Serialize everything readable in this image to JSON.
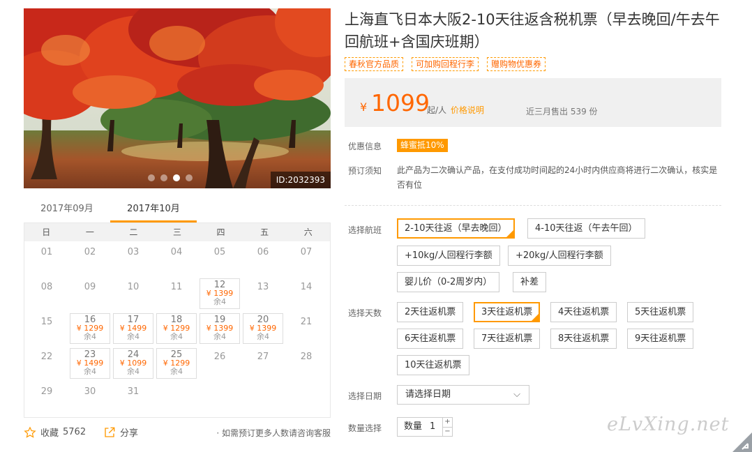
{
  "photo": {
    "id_label": "ID:2032393",
    "dots": 4,
    "active_dot": 2
  },
  "calendar": {
    "months": [
      "2017年09月",
      "2017年10月"
    ],
    "active_month": 1,
    "weekdays": [
      "日",
      "一",
      "二",
      "三",
      "四",
      "五",
      "六"
    ],
    "leading_blanks": 0,
    "days": [
      {
        "day": "01"
      },
      {
        "day": "02"
      },
      {
        "day": "03"
      },
      {
        "day": "04"
      },
      {
        "day": "05"
      },
      {
        "day": "06"
      },
      {
        "day": "07"
      },
      {
        "day": "08"
      },
      {
        "day": "09"
      },
      {
        "day": "10"
      },
      {
        "day": "11"
      },
      {
        "day": "12",
        "price": "¥ 1399",
        "remain": "余4"
      },
      {
        "day": "13"
      },
      {
        "day": "14"
      },
      {
        "day": "15"
      },
      {
        "day": "16",
        "price": "¥ 1299",
        "remain": "余4"
      },
      {
        "day": "17",
        "price": "¥ 1499",
        "remain": "余4"
      },
      {
        "day": "18",
        "price": "¥ 1299",
        "remain": "余4"
      },
      {
        "day": "19",
        "price": "¥ 1399",
        "remain": "余4"
      },
      {
        "day": "20",
        "price": "¥ 1399",
        "remain": "余4"
      },
      {
        "day": "21"
      },
      {
        "day": "22"
      },
      {
        "day": "23",
        "price": "¥ 1499",
        "remain": "余4"
      },
      {
        "day": "24",
        "price": "¥ 1099",
        "remain": "余4"
      },
      {
        "day": "25",
        "price": "¥ 1299",
        "remain": "余4"
      },
      {
        "day": "26"
      },
      {
        "day": "27"
      },
      {
        "day": "28"
      },
      {
        "day": "29"
      },
      {
        "day": "30"
      },
      {
        "day": "31"
      }
    ]
  },
  "footer": {
    "favorite_label": "收藏",
    "favorite_count": "5762",
    "share_label": "分享",
    "consult_text": "· 如需预订更多人数请咨询客服"
  },
  "product": {
    "title": "上海直飞日本大阪2-10天往返含税机票（早去晚回/午去午回航班+含国庆班期）",
    "tags": [
      "春秋官方品质",
      "可加购回程行李",
      "赠购物优惠券"
    ]
  },
  "price": {
    "currency": "¥",
    "value": "1099",
    "unit": "起/人",
    "note": "价格说明",
    "sold": "近三月售出 539 份"
  },
  "promo": {
    "label": "优惠信息",
    "badge": "蜂蜜抵10%"
  },
  "notice": {
    "label": "预订须知",
    "text": "此产品为二次确认产品，在支付成功时间起的24小时内供应商将进行二次确认，核实是否有位"
  },
  "flight": {
    "label": "选择航班",
    "options": [
      "2-10天往返（早去晚回）",
      "4-10天往返（午去午回）",
      "+10kg/人回程行李额",
      "+20kg/人回程行李额",
      "婴儿价（0-2周岁内）",
      "补差"
    ],
    "selected": 0
  },
  "days_select": {
    "label": "选择天数",
    "options": [
      "2天往返机票",
      "3天往返机票",
      "4天往返机票",
      "5天往返机票",
      "6天往返机票",
      "7天往返机票",
      "8天往返机票",
      "9天往返机票",
      "10天往返机票"
    ],
    "selected": 1
  },
  "date_select": {
    "label": "选择日期",
    "placeholder": "请选择日期"
  },
  "quantity": {
    "label": "数量选择",
    "field_label": "数量",
    "value": "1",
    "plus": "+",
    "minus": "−"
  },
  "watermark": "eLvXing.net",
  "colors": {
    "accent": "#ff9900",
    "price": "#ff6600"
  }
}
